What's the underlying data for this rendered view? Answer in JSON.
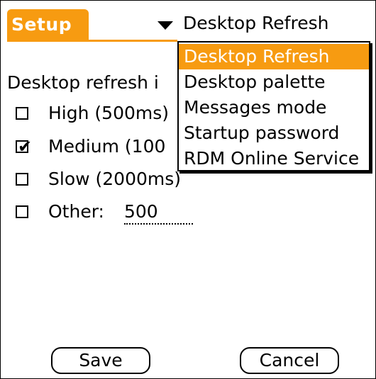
{
  "title": "Setup",
  "category_trigger": {
    "selected_label": "Desktop Refresh",
    "icon": "triangle-down-icon"
  },
  "category_menu": {
    "items": [
      {
        "label": "Desktop Refresh",
        "selected": true
      },
      {
        "label": "Desktop palette",
        "selected": false
      },
      {
        "label": "Messages mode",
        "selected": false
      },
      {
        "label": "Startup password",
        "selected": false
      },
      {
        "label": "RDM Online Service",
        "selected": false
      }
    ]
  },
  "form": {
    "label": "Desktop refresh i",
    "options": [
      {
        "label": "High (500ms)",
        "checked": false
      },
      {
        "label": "Medium (100",
        "checked": true
      },
      {
        "label": "Slow (2000ms)",
        "checked": false
      },
      {
        "label": "Other:",
        "checked": false
      }
    ],
    "other_value": "500"
  },
  "buttons": {
    "save": "Save",
    "cancel": "Cancel"
  },
  "colors": {
    "accent": "#f79b11",
    "background": "#ffffff",
    "text": "#000000"
  }
}
